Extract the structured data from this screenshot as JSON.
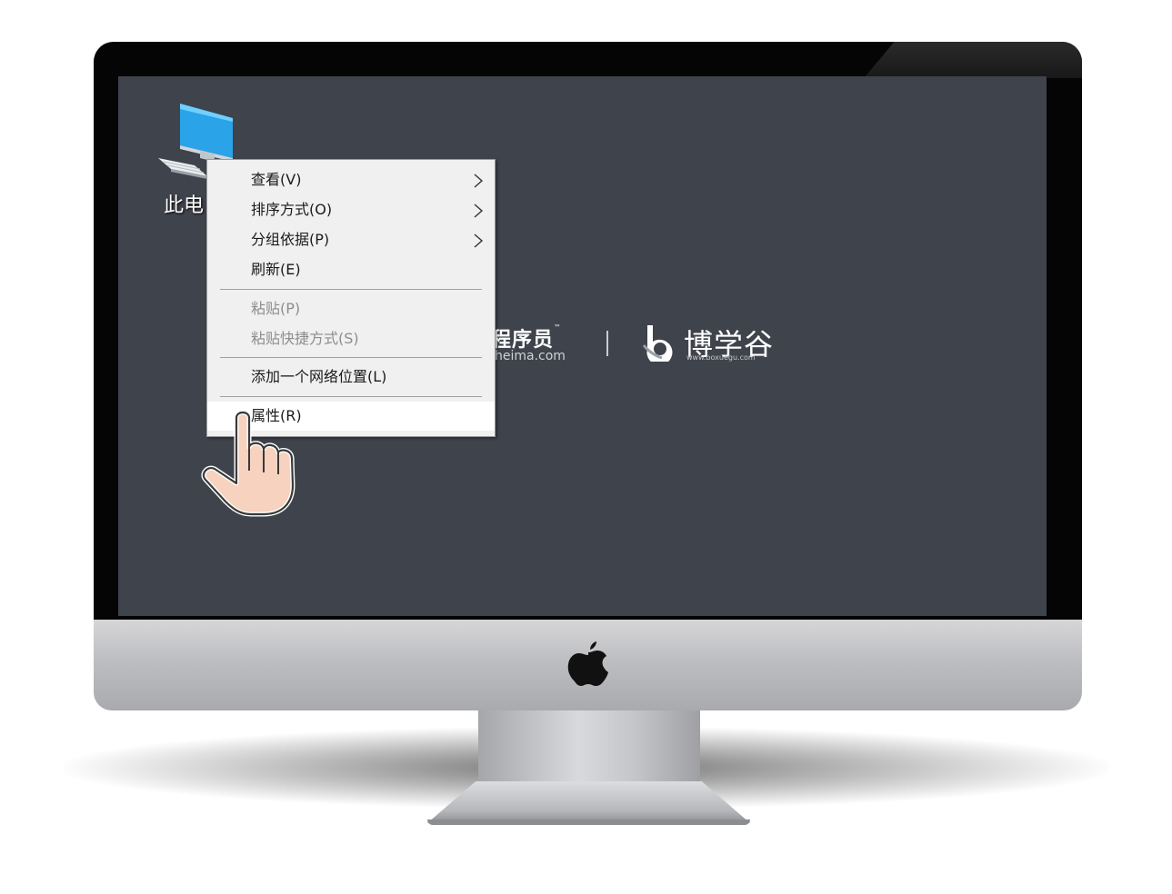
{
  "desktop": {
    "icon_label": "此电",
    "icon": "computer-icon"
  },
  "brand": {
    "left_name": "程序员",
    "left_tm": "™",
    "left_url": "heima.com",
    "right_name": "博学谷",
    "right_url": "www.boxuegu.com"
  },
  "context_menu": {
    "items": [
      {
        "label": "查看(V)",
        "submenu": true,
        "enabled": true
      },
      {
        "label": "排序方式(O)",
        "submenu": true,
        "enabled": true
      },
      {
        "label": "分组依据(P)",
        "submenu": true,
        "enabled": true
      },
      {
        "label": "刷新(E)",
        "submenu": false,
        "enabled": true
      },
      {
        "label": "粘贴(P)",
        "submenu": false,
        "enabled": false
      },
      {
        "label": "粘贴快捷方式(S)",
        "submenu": false,
        "enabled": false
      },
      {
        "label": "添加一个网络位置(L)",
        "submenu": false,
        "enabled": true
      },
      {
        "label": "属性(R)",
        "submenu": false,
        "enabled": true,
        "highlighted": true
      }
    ]
  },
  "colors": {
    "desktop_bg": "#3f434c",
    "menu_bg": "#f0f0f0",
    "menu_highlight": "#ffffff"
  },
  "icons": [
    "computer-icon",
    "chevron-right-icon",
    "hand-pointer-icon",
    "apple-logo-icon",
    "boxuegu-logo-icon"
  ]
}
